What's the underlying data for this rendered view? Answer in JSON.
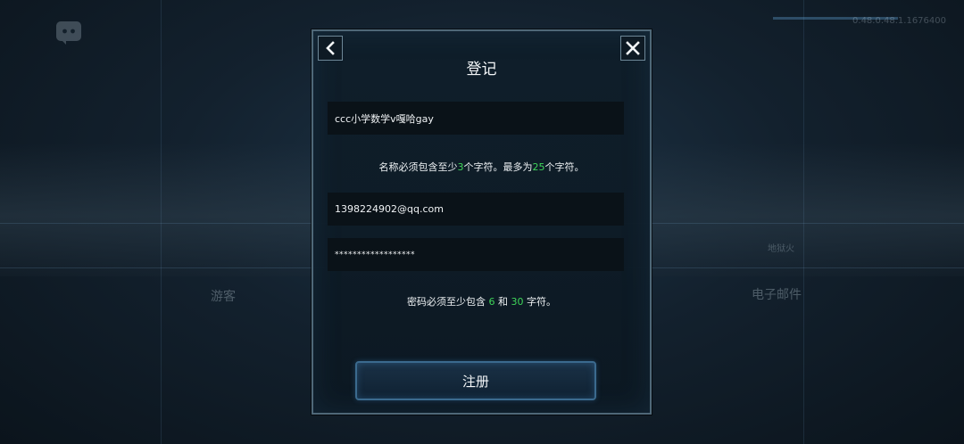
{
  "background": {
    "version": "0.48.0.48.1.1676400",
    "label_left": "游客",
    "label_right": "电子邮件",
    "logo_text": "地狱火"
  },
  "dialog": {
    "title": "登记",
    "username_value": "ccc小学数学v嘎哈gay",
    "name_hint": {
      "prefix": "名称必须包含至少",
      "min": "3",
      "middle": "个字符。最多为",
      "max": "25",
      "suffix": "个字符。"
    },
    "email_value": "1398224902@qq.com",
    "password_value": "******************",
    "password_hint": {
      "prefix": "密码必须至少包含 ",
      "min": "6",
      "middle": " 和 ",
      "max": "30",
      "suffix": " 字符。"
    },
    "register_label": "注册"
  },
  "colors": {
    "accent_green": "#3fd65a",
    "panel_border": "#4f6878",
    "button_border": "#3b6a8e"
  },
  "icons": {
    "back": "chevron-left-icon",
    "close": "close-icon",
    "discord": "discord-icon"
  }
}
